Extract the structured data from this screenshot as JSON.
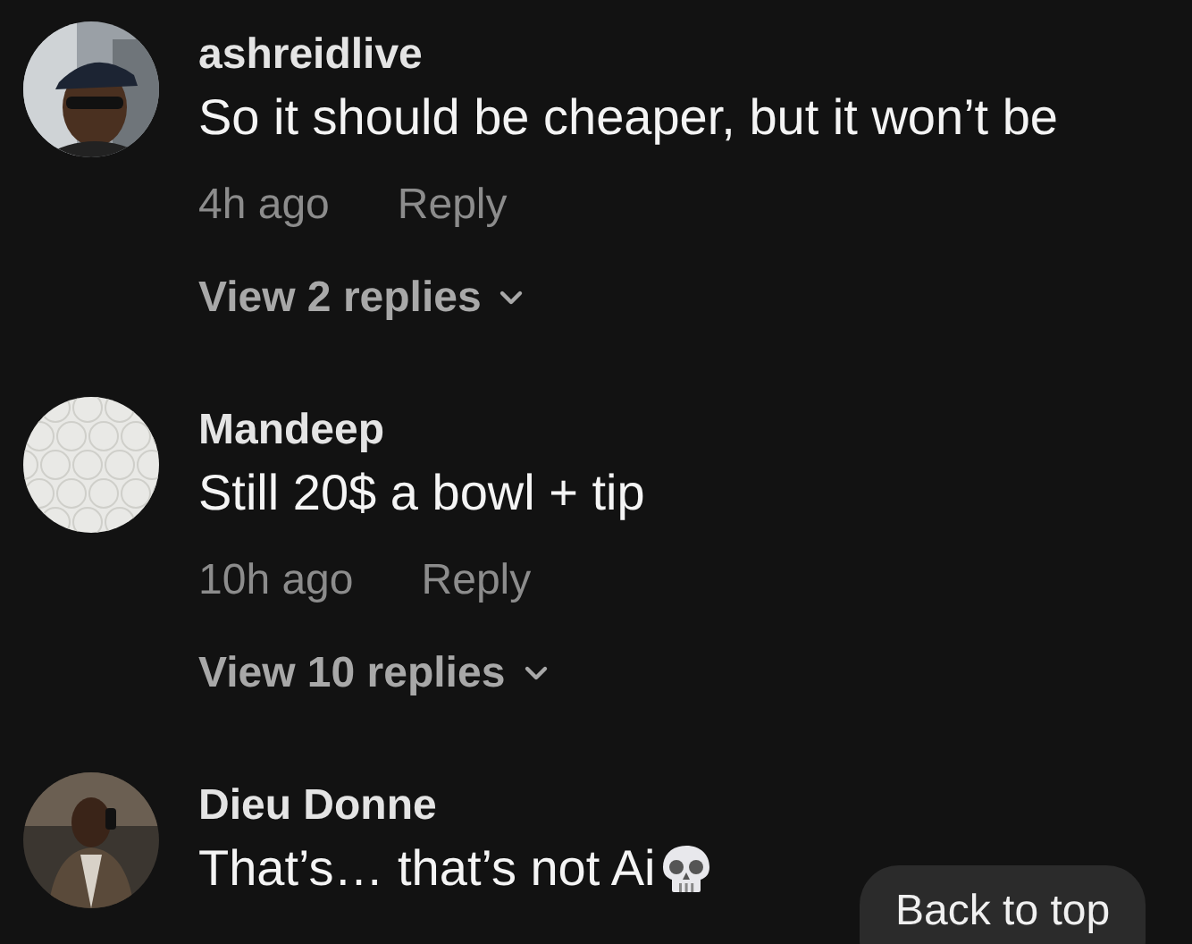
{
  "comments": [
    {
      "username": "ashreidlive",
      "text": "So it should be cheaper, but it won’t be",
      "emoji": false,
      "time": "4h ago",
      "reply": "Reply",
      "replies": "View 2 replies"
    },
    {
      "username": "Mandeep",
      "text": "Still 20$ a bowl + tip",
      "emoji": false,
      "time": "10h ago",
      "reply": "Reply",
      "replies": "View 10 replies"
    },
    {
      "username": "Dieu Donne",
      "text": "That’s… that’s not Ai",
      "emoji": true
    }
  ],
  "back_to_top": "Back to top"
}
